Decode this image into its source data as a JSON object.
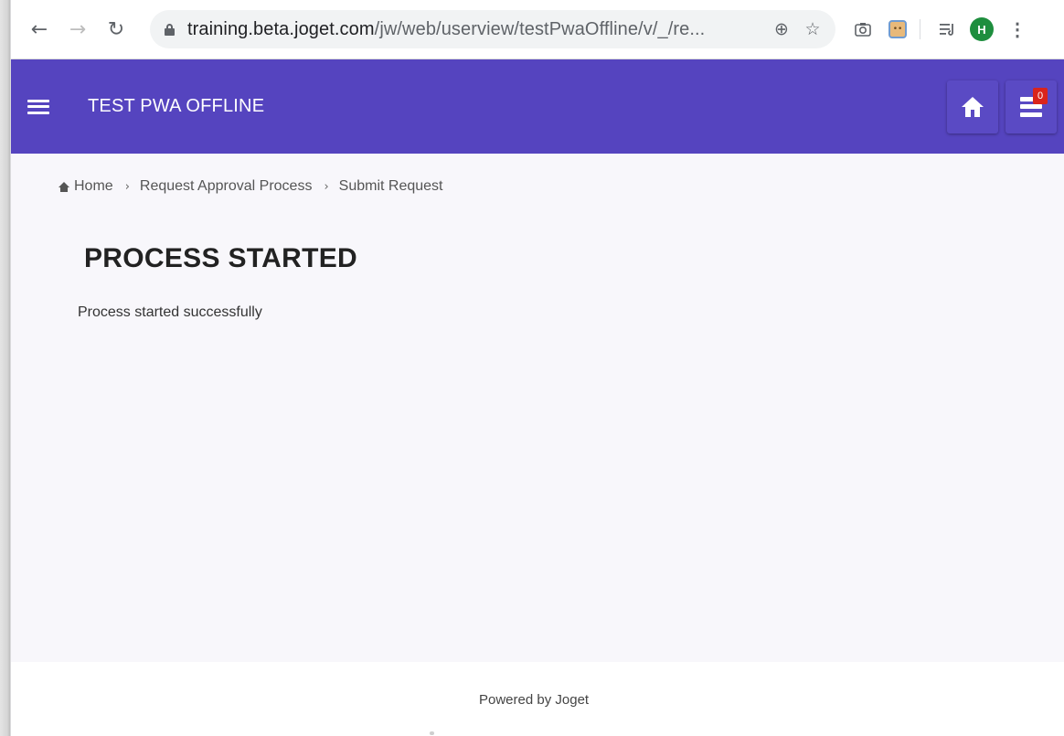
{
  "browser": {
    "url_domain": "training.beta.joget.com",
    "url_path": "/jw/web/userview/testPwaOffline/v/_/re...",
    "profile_initial": "H",
    "icons": [
      "back-icon",
      "forward-icon",
      "reload-icon",
      "lock-icon",
      "add-icon",
      "star-icon",
      "camera-icon",
      "extension-icon",
      "reading-list-icon",
      "kebab-menu-icon"
    ]
  },
  "header": {
    "title": "TEST PWA OFFLINE",
    "badge_count": "0",
    "color": "#5544bf"
  },
  "breadcrumb": {
    "items": [
      "Home",
      "Request Approval Process",
      "Submit Request"
    ]
  },
  "main": {
    "heading": "PROCESS STARTED",
    "message": "Process started successfully"
  },
  "footer": {
    "text": "Powered by Joget"
  }
}
